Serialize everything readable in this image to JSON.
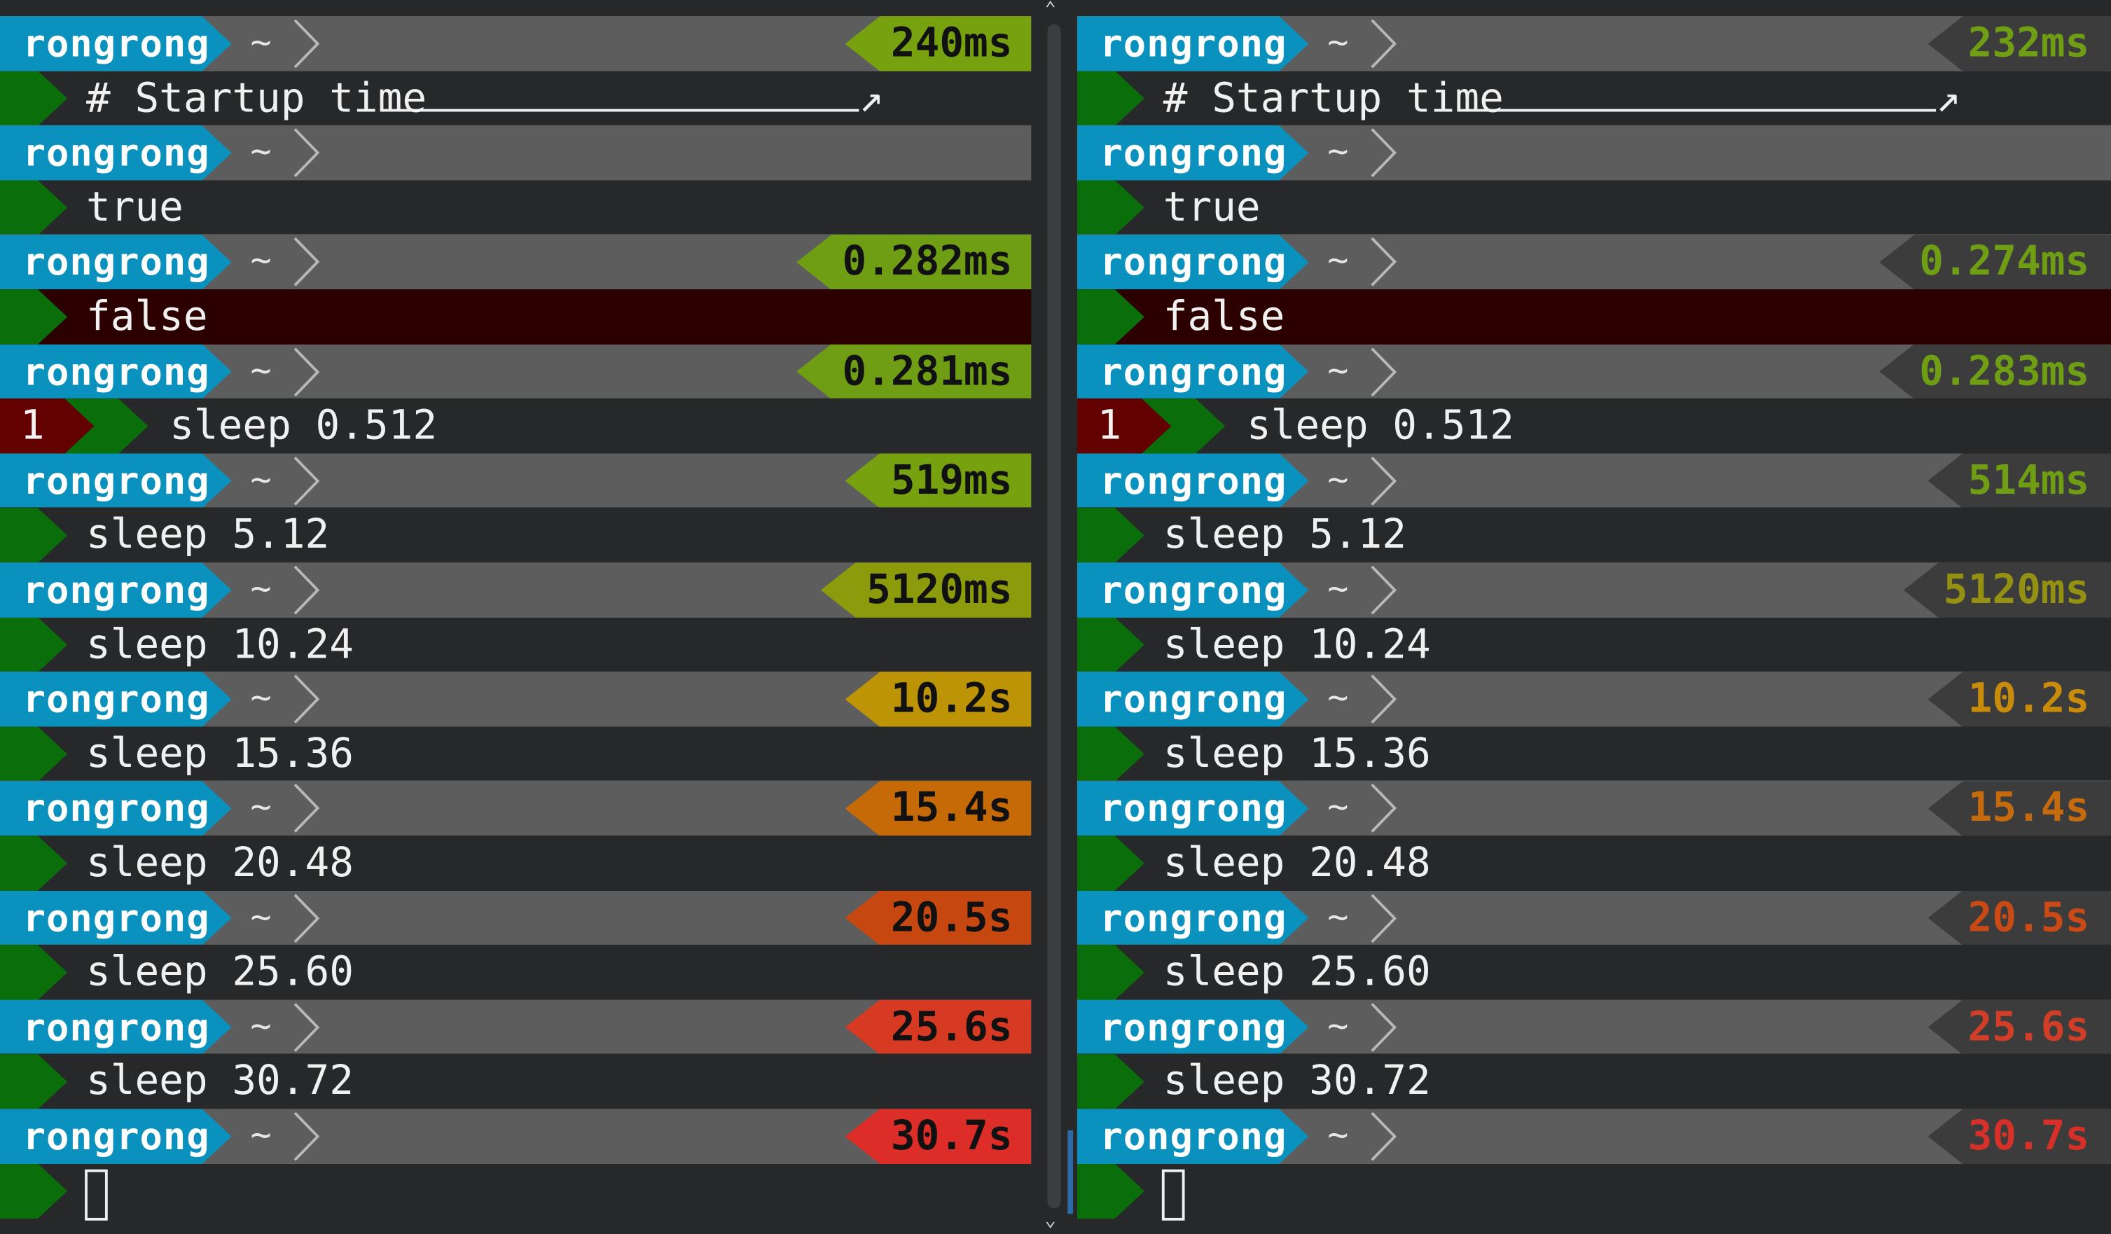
{
  "user": "rongrong",
  "dir": "~",
  "commands": [
    {
      "kind": "comment",
      "text": "# Startup time"
    },
    {
      "kind": "plain",
      "text": "true"
    },
    {
      "kind": "error",
      "text": "false"
    },
    {
      "kind": "status",
      "status": "1",
      "text": "sleep 0.512"
    },
    {
      "kind": "plain",
      "text": "sleep 5.12"
    },
    {
      "kind": "plain",
      "text": "sleep 10.24"
    },
    {
      "kind": "plain",
      "text": "sleep 15.36"
    },
    {
      "kind": "plain",
      "text": "sleep 20.48"
    },
    {
      "kind": "plain",
      "text": "sleep 25.60"
    },
    {
      "kind": "plain",
      "text": "sleep 30.72"
    },
    {
      "kind": "cursor",
      "text": ""
    }
  ],
  "left_pane": {
    "style": "filled",
    "durations": [
      "240ms",
      "",
      "0.282ms",
      "0.281ms",
      "519ms",
      "5120ms",
      "10.2s",
      "15.4s",
      "20.5s",
      "25.6s",
      "30.7s"
    ],
    "colors": [
      "#78a10f",
      "",
      "#6f9d13",
      "#6f9d13",
      "#78a10f",
      "#8b9b0c",
      "#bd9405",
      "#c66a08",
      "#c6470f",
      "#d63a22",
      "#dc2d28"
    ]
  },
  "right_pane": {
    "style": "text",
    "durations": [
      "232ms",
      "",
      "0.274ms",
      "0.283ms",
      "514ms",
      "5120ms",
      "10.2s",
      "15.4s",
      "20.5s",
      "25.6s",
      "30.7s"
    ],
    "colors": [
      "#6f9d13",
      "",
      "#6f9d13",
      "#6f9d13",
      "#6f9d13",
      "#949012",
      "#c88b0a",
      "#c56a0d",
      "#c94a14",
      "#d13d27",
      "#d63028"
    ]
  },
  "scrollbar": {
    "up_arrow": "⌃",
    "down_arrow": "⌄"
  }
}
